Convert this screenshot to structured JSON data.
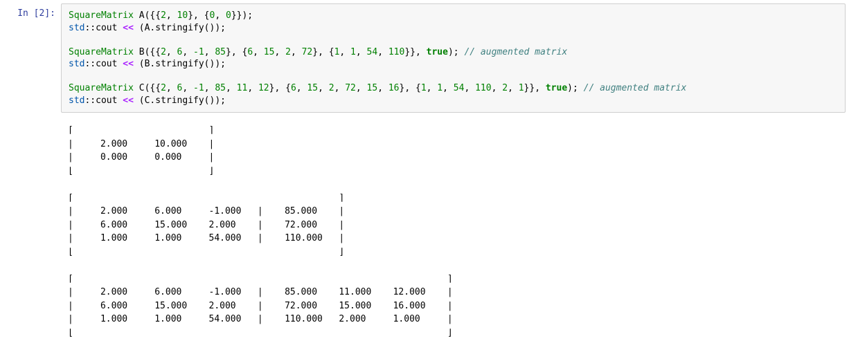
{
  "prompt": "In [2]:",
  "code": {
    "l1_type": "SquareMatrix",
    "l1_var": " A",
    "l1_open": "({{",
    "l1_n1": "2",
    "l1_c1": ", ",
    "l1_n2": "10",
    "l1_c2": "}, {",
    "l1_n3": "0",
    "l1_c3": ", ",
    "l1_n4": "0",
    "l1_close": "}});",
    "l2_ns": "std",
    "l2_scope": "::",
    "l2_cout": "cout ",
    "l2_op": "<<",
    "l2_rest": " (A.stringify());",
    "l4_type": "SquareMatrix",
    "l4_var": " B",
    "l4_open": "({{",
    "l4_n1": "2",
    "l4_c1": ", ",
    "l4_n2": "6",
    "l4_c2": ", ",
    "l4_n3": "-1",
    "l4_c3": ", ",
    "l4_n4": "85",
    "l4_c4": "}, {",
    "l4_n5": "6",
    "l4_c5": ", ",
    "l4_n6": "15",
    "l4_c6": ", ",
    "l4_n7": "2",
    "l4_c7": ", ",
    "l4_n8": "72",
    "l4_c8": "}, {",
    "l4_n9": "1",
    "l4_c9": ", ",
    "l4_n10": "1",
    "l4_c10": ", ",
    "l4_n11": "54",
    "l4_c11": ", ",
    "l4_n12": "110",
    "l4_close": "}}, ",
    "l4_true": "true",
    "l4_end": "); ",
    "l4_comment": "// augmented matrix",
    "l5_ns": "std",
    "l5_scope": "::",
    "l5_cout": "cout ",
    "l5_op": "<<",
    "l5_rest": " (B.stringify());",
    "l7_type": "SquareMatrix",
    "l7_var": " C",
    "l7_open": "({{",
    "l7_n1": "2",
    "l7_c1": ", ",
    "l7_n2": "6",
    "l7_c2": ", ",
    "l7_n3": "-1",
    "l7_c3": ", ",
    "l7_n4": "85",
    "l7_c4": ", ",
    "l7_n5": "11",
    "l7_c5": ", ",
    "l7_n6": "12",
    "l7_c6": "}, {",
    "l7_n7": "6",
    "l7_c7": ", ",
    "l7_n8": "15",
    "l7_c8": ", ",
    "l7_n9": "2",
    "l7_c9": ", ",
    "l7_n10": "72",
    "l7_c10": ", ",
    "l7_n11": "15",
    "l7_c11": ", ",
    "l7_n12": "16",
    "l7_c12": "}, {",
    "l7_n13": "1",
    "l7_c13": ", ",
    "l7_n14": "1",
    "l7_c14": ", ",
    "l7_n15": "54",
    "l7_c15": ", ",
    "l7_n16": "110",
    "l7_c16": ", ",
    "l7_n17": "2",
    "l7_c17": ", ",
    "l7_n18": "1",
    "l7_close": "}}, ",
    "l7_true": "true",
    "l7_end": "); ",
    "l7_comment": "// augmented matrix",
    "l8_ns": "std",
    "l8_scope": "::",
    "l8_cout": "cout ",
    "l8_op": "<<",
    "l8_rest": " (C.stringify());"
  },
  "output": "⌈                         ⌉\n|     2.000     10.000    |\n|     0.000     0.000     |\n⌊                         ⌋\n\n⌈                                                 ⌉\n|     2.000     6.000     -1.000   |    85.000    |\n|     6.000     15.000    2.000    |    72.000    |\n|     1.000     1.000     54.000   |    110.000   |\n⌊                                                 ⌋\n\n⌈                                                                     ⌉\n|     2.000     6.000     -1.000   |    85.000    11.000    12.000    |\n|     6.000     15.000    2.000    |    72.000    15.000    16.000    |\n|     1.000     1.000     54.000   |    110.000   2.000     1.000     |\n⌊                                                                     ⌋"
}
